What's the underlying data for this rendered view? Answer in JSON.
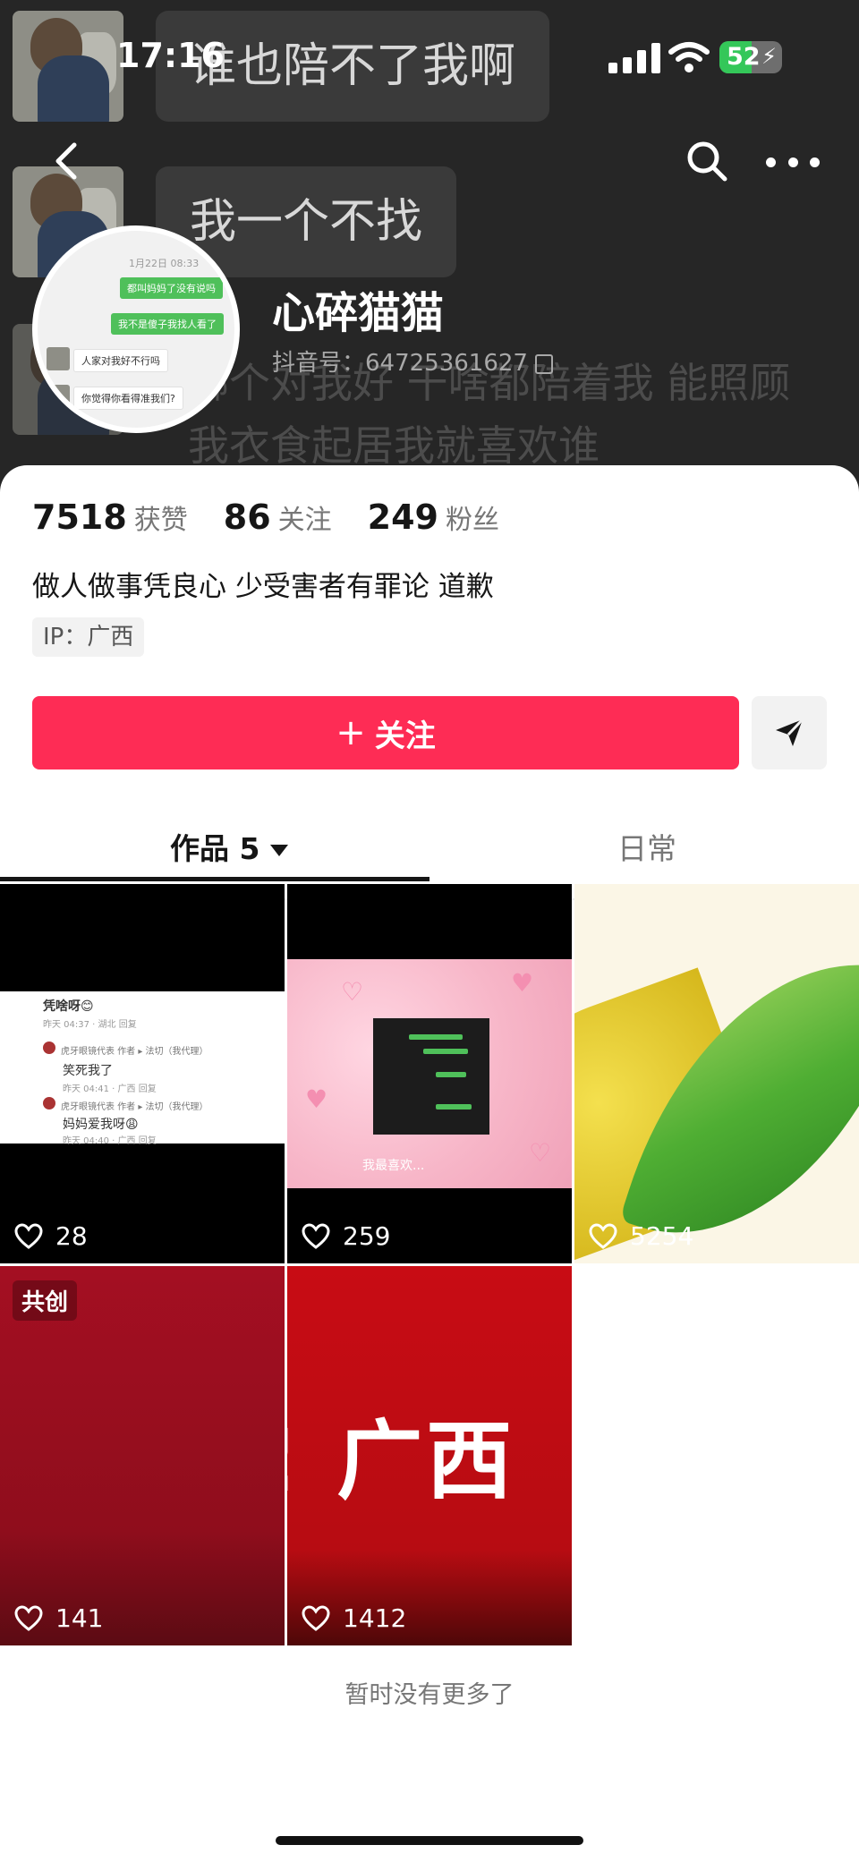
{
  "status_bar": {
    "time": "17:16",
    "battery": "52",
    "battery_level": 0.52
  },
  "cover": {
    "bubbles": [
      "谁也陪不了我啊",
      "我一个不找"
    ],
    "overlay_lines": [
      "哪个对我好 干啥都陪着我 能照顾",
      "我衣食起居我就喜欢谁"
    ]
  },
  "avatar_chat": {
    "date": "1月22日 08:33",
    "sent": [
      "都叫妈妈了没有说吗",
      "我不是傻子我找人看了"
    ],
    "received": [
      "人家对我好不行吗",
      "你觉得你看得准我们?"
    ]
  },
  "profile": {
    "name": "心碎猫猫",
    "id": "抖音号：64725361627"
  },
  "stats": [
    {
      "value": "7518",
      "label": "获赞"
    },
    {
      "value": "86",
      "label": "关注"
    },
    {
      "value": "249",
      "label": "粉丝"
    }
  ],
  "bio": "做人做事凭良心 少受害者有罪论 道歉",
  "ip": "IP：广西",
  "follow_button": {
    "icon": "+",
    "label": "关注"
  },
  "tabs": {
    "works_label": "作品 5",
    "daily_label": "日常"
  },
  "videos": [
    {
      "likes": "28",
      "comments": [
        {
          "text": "凭啥呀😊",
          "meta": "昨天 04:37 · 湖北    回复"
        },
        {
          "text": "笑死我了",
          "author": "虎牙眼镜代表 作者 ▸ 法切（我代理）",
          "meta": "昨天 04:41 · 广西    回复"
        },
        {
          "text": "妈妈爱我呀😩",
          "author": "虎牙眼镜代表 作者 ▸ 法切（我代理）",
          "meta": "昨天 04:40 · 广西    回复"
        }
      ]
    },
    {
      "likes": "259",
      "caption": "我最喜欢..."
    },
    {
      "likes": "5254"
    },
    {
      "likes": "141",
      "badge": "共创"
    },
    {
      "likes": "1412",
      "big_text": "! 广西"
    }
  ],
  "footer_text": "暂时没有更多了",
  "icons": {
    "back": "chevron-left-icon",
    "search": "search-icon",
    "more": "more-horizontal-icon",
    "share": "send-icon",
    "like": "heart-outline-icon",
    "copy": "copy-icon"
  },
  "colors": {
    "accent": "#fe2c55",
    "cover_bg": "#262626"
  }
}
